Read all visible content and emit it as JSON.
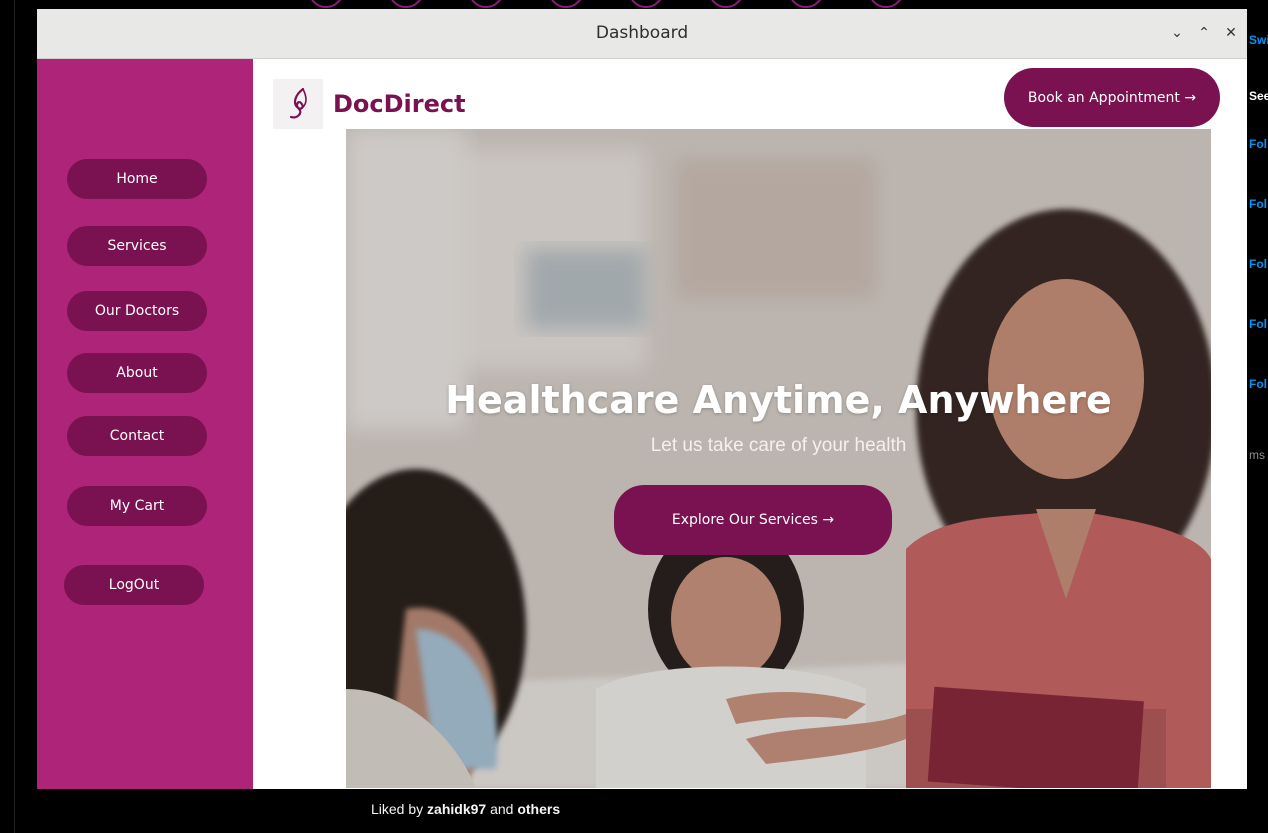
{
  "window": {
    "title": "Dashboard",
    "controls": {
      "minimize": "⌄",
      "maximize": "⌃",
      "close": "✕"
    }
  },
  "brand": {
    "name": "DocDirect",
    "logo_icon": "leaf-drop-icon"
  },
  "sidebar": {
    "items": [
      {
        "label": "Home"
      },
      {
        "label": "Services"
      },
      {
        "label": "Our Doctors"
      },
      {
        "label": "About"
      },
      {
        "label": "Contact"
      },
      {
        "label": "My Cart"
      },
      {
        "label": "LogOut"
      }
    ]
  },
  "header": {
    "book_label": "Book an Appointment →"
  },
  "hero": {
    "title": "Healthcare Anytime, Anywhere",
    "subtitle": "Let us take care of your health",
    "cta_label": "Explore Our Services →"
  },
  "background": {
    "right_items": [
      "Swi",
      "See",
      "Fol",
      "Fol",
      "Fol",
      "Fol",
      "Fol",
      "ms"
    ],
    "liked_by_prefix": "Liked by",
    "liked_by_user": "zahidk97",
    "liked_by_and": "and",
    "liked_by_others": "others"
  },
  "colors": {
    "sidebar": "#ad2478",
    "button": "#7a1150",
    "brand": "#7a1150"
  }
}
